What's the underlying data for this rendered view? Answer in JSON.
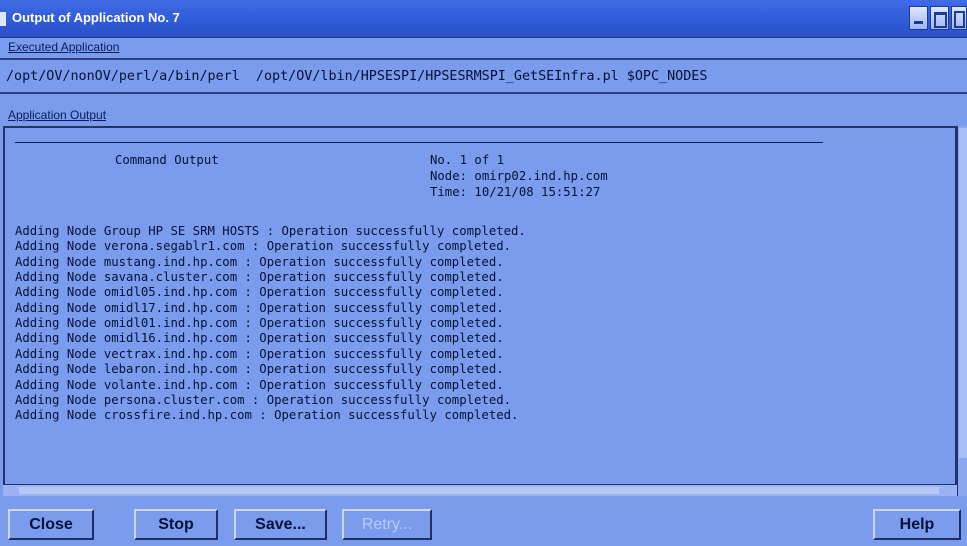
{
  "window": {
    "title": "Output of Application No. 7",
    "accent": "#2f5ad8",
    "background": "#7b9bec"
  },
  "executed": {
    "label": "Executed Application",
    "command": "/opt/OV/nonOV/perl/a/bin/perl  /opt/OV/lbin/HPSESPI/HPSESRMSPI_GetSEInfra.pl $OPC_NODES"
  },
  "output": {
    "label": "Application Output",
    "header": {
      "command_output": "Command Output",
      "no": "No. 1 of 1",
      "node": "Node: omirp02.ind.hp.com",
      "time": "Time: 10/21/08 15:51:27"
    },
    "lines": [
      "Adding Node Group HP SE SRM HOSTS : Operation successfully completed.",
      "Adding Node verona.segablr1.com : Operation successfully completed.",
      "Adding Node mustang.ind.hp.com : Operation successfully completed.",
      "Adding Node savana.cluster.com : Operation successfully completed.",
      "Adding Node omidl05.ind.hp.com : Operation successfully completed.",
      "Adding Node omidl17.ind.hp.com : Operation successfully completed.",
      "Adding Node omidl01.ind.hp.com : Operation successfully completed.",
      "Adding Node omidl16.ind.hp.com : Operation successfully completed.",
      "Adding Node vectrax.ind.hp.com : Operation successfully completed.",
      "Adding Node lebaron.ind.hp.com : Operation successfully completed.",
      "Adding Node volante.ind.hp.com : Operation successfully completed.",
      "Adding Node persona.cluster.com : Operation successfully completed.",
      "Adding Node crossfire.ind.hp.com : Operation successfully completed."
    ]
  },
  "buttons": {
    "close": "Close",
    "stop": "Stop",
    "save": "Save...",
    "retry": "Retry...",
    "help": "Help"
  },
  "icons": {
    "minimize": "minimize-icon",
    "maximize": "maximize-icon",
    "close": "close-icon"
  }
}
